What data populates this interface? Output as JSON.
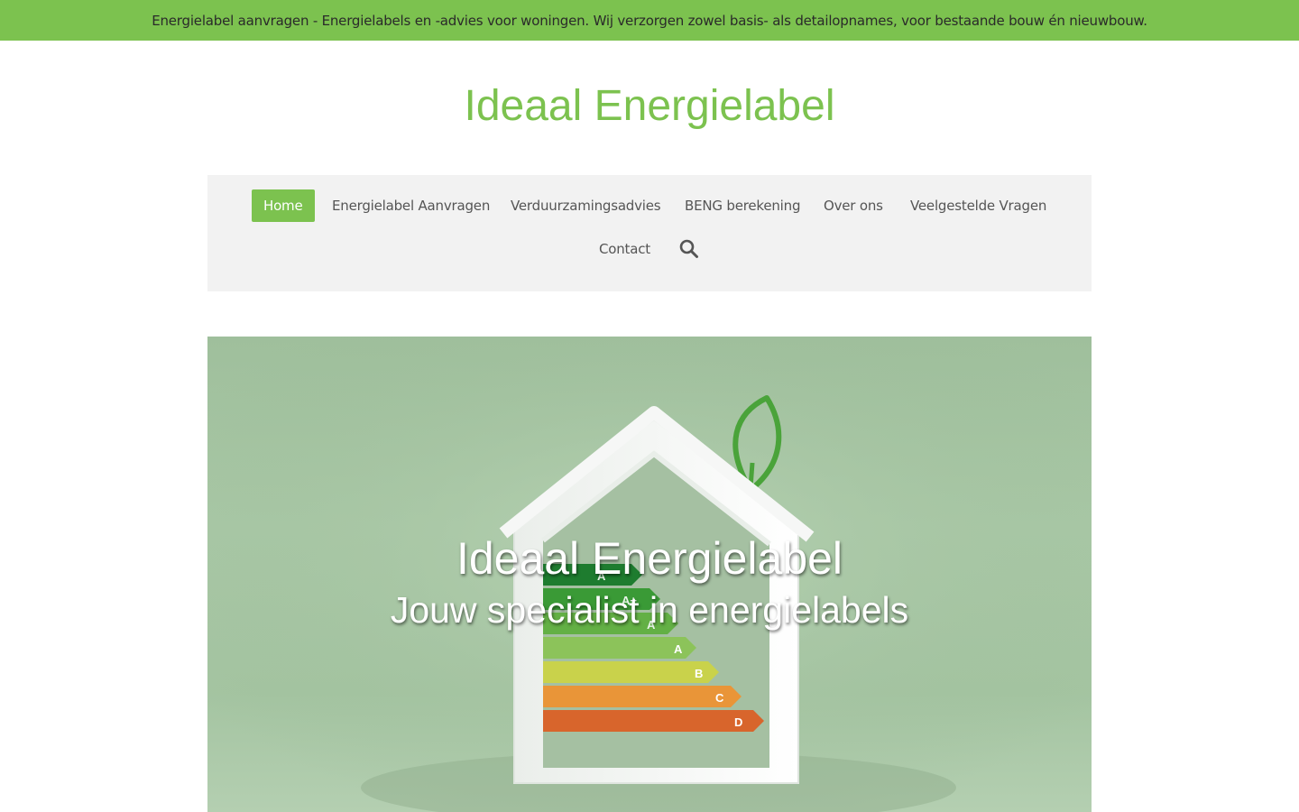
{
  "topbar": {
    "text": "Energielabel aanvragen -  Energielabels en -advies voor woningen. Wij verzorgen zowel basis- als detailopnames, voor bestaande bouw én nieuwbouw."
  },
  "site": {
    "title": "Ideaal Energielabel"
  },
  "nav": {
    "items": [
      {
        "label": "Home",
        "active": true
      },
      {
        "label": "Energielabel Aanvragen"
      },
      {
        "label": "Verduurzamingsadvies"
      },
      {
        "label": "BENG berekening"
      },
      {
        "label": "Over ons"
      },
      {
        "label": "Veelgestelde Vragen"
      },
      {
        "label": "Contact"
      }
    ],
    "search_icon": "search-icon"
  },
  "hero": {
    "title": "Ideaal Energielabel",
    "subtitle": "Jouw specialist in energielabels",
    "label_letters": [
      "A",
      "A+",
      "A",
      "A",
      "B",
      "C",
      "D"
    ]
  },
  "colors": {
    "brand_green": "#7cc24f",
    "nav_background": "#f2f2f2",
    "nav_text": "#555555",
    "topbar_text": "#2a2a2a"
  }
}
